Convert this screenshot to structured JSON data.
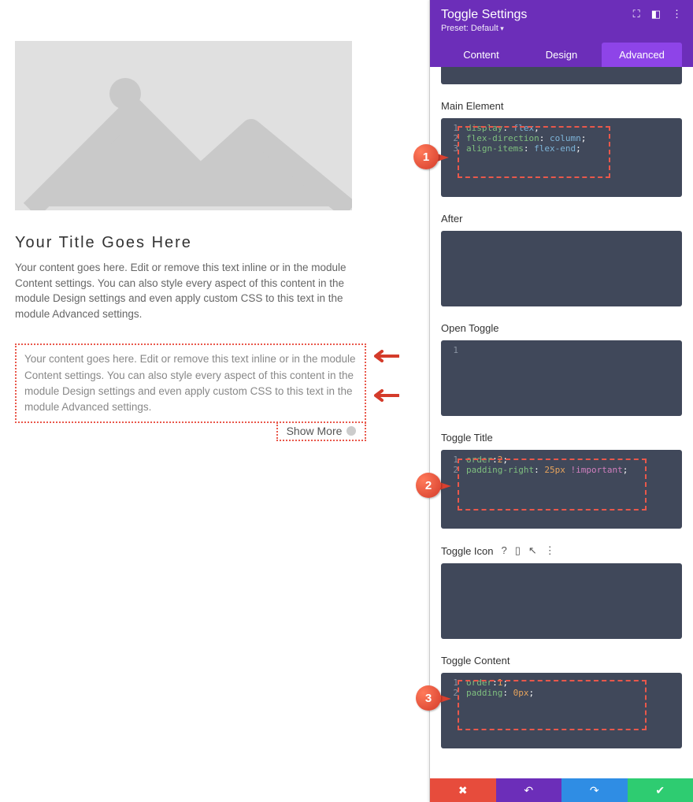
{
  "preview": {
    "title": "Your Title Goes Here",
    "body": "Your content goes here. Edit or remove this text inline or in the module Content settings. You can also style every aspect of this content in the module Design settings and even apply custom CSS to this text in the module Advanced settings.",
    "toggle_body": "Your content goes here. Edit or remove this text inline or in the module Content settings. You can also style every aspect of this content in the module Design settings and even apply custom CSS to this text in the module Advanced settings.",
    "toggle_button": "Show More"
  },
  "sidebar": {
    "title": "Toggle Settings",
    "preset": "Preset: Default",
    "tabs": {
      "content": "Content",
      "design": "Design",
      "advanced": "Advanced"
    },
    "fields": {
      "main_element": {
        "label": "Main Element",
        "lines": [
          [
            {
              "t": "prop",
              "v": "display"
            },
            {
              "t": "punc",
              "v": ": "
            },
            {
              "t": "val",
              "v": "flex"
            },
            {
              "t": "punc",
              "v": ";"
            }
          ],
          [
            {
              "t": "prop",
              "v": "flex-direction"
            },
            {
              "t": "punc",
              "v": ": "
            },
            {
              "t": "val",
              "v": "column"
            },
            {
              "t": "punc",
              "v": ";"
            }
          ],
          [
            {
              "t": "prop",
              "v": "align-items"
            },
            {
              "t": "punc",
              "v": ": "
            },
            {
              "t": "val",
              "v": "flex-end"
            },
            {
              "t": "punc",
              "v": ";"
            }
          ]
        ]
      },
      "after": {
        "label": "After",
        "lines": []
      },
      "open_toggle": {
        "label": "Open Toggle",
        "lines": [
          []
        ]
      },
      "toggle_title": {
        "label": "Toggle Title",
        "lines": [
          [
            {
              "t": "prop",
              "v": "order"
            },
            {
              "t": "punc",
              "v": ":"
            },
            {
              "t": "num",
              "v": "2"
            },
            {
              "t": "punc",
              "v": ";"
            }
          ],
          [
            {
              "t": "prop",
              "v": "padding-right"
            },
            {
              "t": "punc",
              "v": ": "
            },
            {
              "t": "num",
              "v": "25px"
            },
            {
              "t": "punc",
              "v": " "
            },
            {
              "t": "imp",
              "v": "!important"
            },
            {
              "t": "punc",
              "v": ";"
            }
          ]
        ]
      },
      "toggle_icon": {
        "label": "Toggle Icon",
        "lines": []
      },
      "toggle_content": {
        "label": "Toggle Content",
        "lines": [
          [
            {
              "t": "prop",
              "v": "order"
            },
            {
              "t": "punc",
              "v": ":"
            },
            {
              "t": "num",
              "v": "1"
            },
            {
              "t": "punc",
              "v": ";"
            }
          ],
          [
            {
              "t": "prop",
              "v": "padding"
            },
            {
              "t": "punc",
              "v": ": "
            },
            {
              "t": "num",
              "v": "0px"
            },
            {
              "t": "punc",
              "v": ";"
            }
          ]
        ]
      }
    }
  },
  "callouts": {
    "c1": "1",
    "c2": "2",
    "c3": "3"
  }
}
